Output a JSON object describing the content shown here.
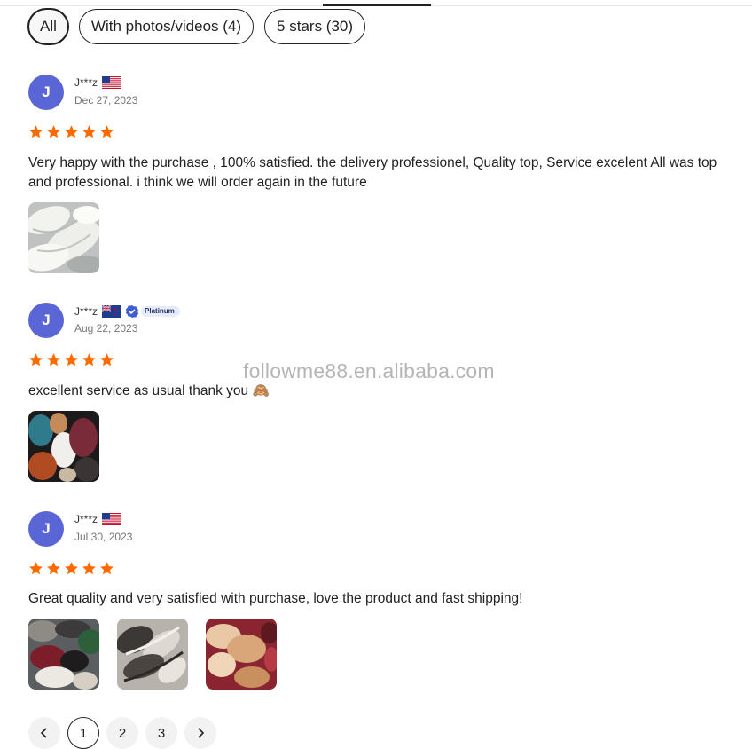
{
  "filters": [
    {
      "label": "All"
    },
    {
      "label": "With photos/videos (4)"
    },
    {
      "label": "5 stars (30)"
    }
  ],
  "reviews": [
    {
      "avatar": "J",
      "name": "J***z",
      "flag": "US",
      "date": "Dec 27, 2023",
      "rating": 5,
      "text": "Very happy with the purchase , 100% satisfied. the delivery professionel, Quality top, Service excelent All was top and professional. i think we will order again in the future",
      "photo_count": 1
    },
    {
      "avatar": "J",
      "name": "J***z",
      "flag": "NZ",
      "badge": "Platinum",
      "date": "Aug 22, 2023",
      "rating": 5,
      "text": "excellent service as usual thank you 🙈",
      "photo_count": 1
    },
    {
      "avatar": "J",
      "name": "J***z",
      "flag": "US",
      "date": "Jul 30, 2023",
      "rating": 5,
      "text": "Great quality and very satisfied with purchase, love the product and fast shipping!",
      "photo_count": 3
    }
  ],
  "watermark": "followme88.en.alibaba.com",
  "pagination": {
    "prev_icon": "chevron-left-icon",
    "next_icon": "chevron-right-icon",
    "pages": [
      "1",
      "2",
      "3"
    ],
    "current": "1"
  },
  "colors": {
    "star": "#ff6a00",
    "avatar": "#5a66d6",
    "badge_bg": "#e6ecfb"
  }
}
